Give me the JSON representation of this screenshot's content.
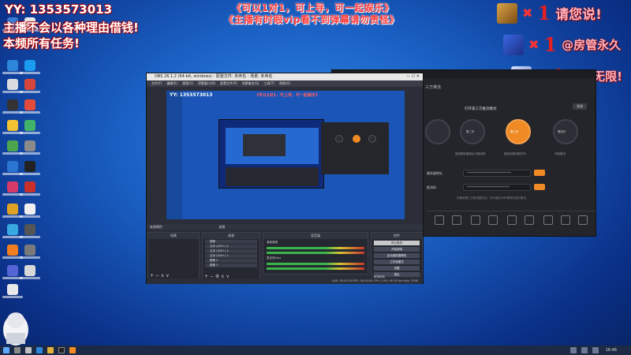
{
  "overlay": {
    "left_line1": "YY: 1353573013",
    "left_line2": "主播不会以各种理由借钱!",
    "left_line3": "本频所有任务!",
    "center_line1": "《可以1对1，可上导，可一起娱乐》",
    "center_line2": "《主播有时眼vip看不到弹幕请勿责怪》"
  },
  "alerts": [
    {
      "count": "1",
      "text": "请您说!",
      "avatar_color": "#c8913a"
    },
    {
      "count": "1",
      "text": "@房管永久",
      "avatar_color": "#2f53c7"
    },
    {
      "count": "1",
      "text": "车位无限!",
      "avatar_color": "#b8c6e6"
    }
  ],
  "obs": {
    "title": "OBS 26.1.2 (64-bit, windows) - 配置文件: 未命名 - 场景: 未命名",
    "menu": [
      "文件(F)",
      "编辑(E)",
      "视图(V)",
      "停靠窗口(D)",
      "配置文件(P)",
      "场景集合(S)",
      "工具(T)",
      "帮助(H)"
    ],
    "toolbar_label": "来源属性",
    "toolbar_filters": "滤镜",
    "panels": {
      "scenes": "场景",
      "sources": "来源",
      "mixer": "混音器",
      "controls": "控件"
    },
    "sources": [
      "图像",
      "文本 (GDI+) 4",
      "文本 (GDI+) 3",
      "文本 (GDI+) 2",
      "图像 2",
      "图像 3",
      "图像 4"
    ],
    "mixer_tracks": [
      "桌面音频",
      "麦克风/Aux"
    ],
    "controls": [
      "停止推流",
      "开始录制",
      "启动虚拟摄像机",
      "工作室模式",
      "设置",
      "退出"
    ],
    "dock_tab": "转场特效",
    "status": "LIVE: 00:02:34   REC: 00:00:00   CPU: 1.9%, 60.00 fps   kb/s: 2598"
  },
  "stream_app": {
    "header": "三方推流",
    "step_title": "打开第三方推流模式",
    "steps": [
      {
        "label": "第一步",
        "sub": "开启推流模式"
      },
      {
        "label": "第二步",
        "sub": "复制服务器地址与推流码"
      },
      {
        "label": "第三步",
        "sub": "粘贴到推流软件中"
      },
      {
        "label": "第四步",
        "sub": "开始推流"
      }
    ],
    "server_label": "服务器地址",
    "server_value": "****************************",
    "key_label": "推流码",
    "key_value": "***************************",
    "copy_label": "复制",
    "note": "切换到第三方推流模式后，仍可通过OBS等软件进行推流",
    "close_label": "关闭"
  },
  "taskbar": {
    "time": "16:46"
  }
}
